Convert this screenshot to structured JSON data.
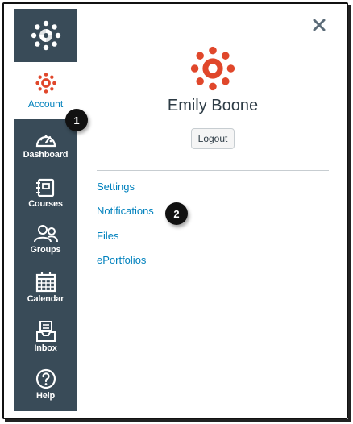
{
  "nav": {
    "account_label": "Account",
    "items": [
      {
        "label": "Dashboard",
        "icon": "dashboard-icon"
      },
      {
        "label": "Courses",
        "icon": "courses-icon"
      },
      {
        "label": "Groups",
        "icon": "groups-icon"
      },
      {
        "label": "Calendar",
        "icon": "calendar-icon"
      },
      {
        "label": "Inbox",
        "icon": "inbox-icon"
      },
      {
        "label": "Help",
        "icon": "help-icon"
      }
    ]
  },
  "account_panel": {
    "user_name": "Emily Boone",
    "logout_label": "Logout",
    "links": [
      "Settings",
      "Notifications",
      "Files",
      "ePortfolios"
    ]
  },
  "callouts": [
    "1",
    "2"
  ],
  "colors": {
    "nav_bg": "#394b58",
    "brand_red": "#e0472b",
    "link_blue": "#0081bd"
  }
}
